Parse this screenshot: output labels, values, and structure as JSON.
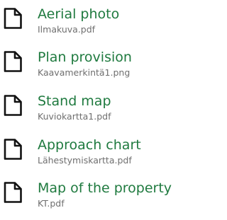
{
  "files": [
    {
      "title": "Aerial photo",
      "filename": "Ilmakuva.pdf",
      "icon": "file-icon"
    },
    {
      "title": "Plan provision",
      "filename": "Kaavamerkintä1.png",
      "icon": "file-icon"
    },
    {
      "title": "Stand map",
      "filename": "Kuviokartta1.pdf",
      "icon": "file-icon"
    },
    {
      "title": "Approach chart",
      "filename": "Lähestymiskartta.pdf",
      "icon": "file-icon"
    },
    {
      "title": "Map of the property",
      "filename": "KT.pdf",
      "icon": "file-icon"
    }
  ],
  "colors": {
    "link": "#1f7a3f",
    "secondary_text": "#6f6f6f",
    "icon_stroke": "#111111"
  }
}
